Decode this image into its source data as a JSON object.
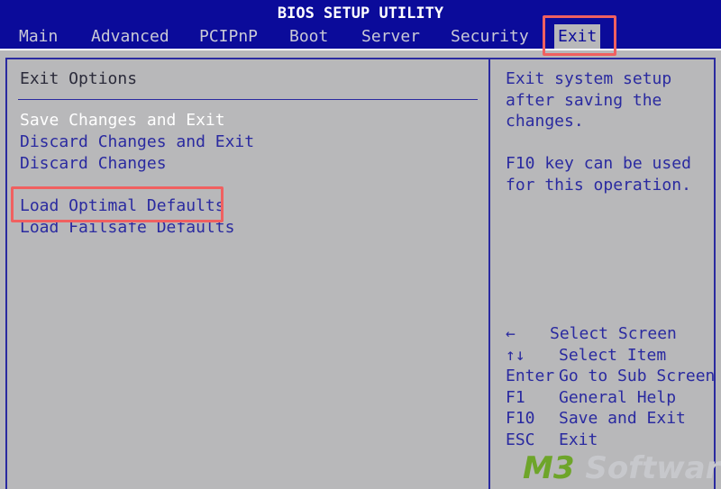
{
  "title": "BIOS SETUP UTILITY",
  "menu": [
    {
      "label": "Main"
    },
    {
      "label": "Advanced"
    },
    {
      "label": "PCIPnP"
    },
    {
      "label": "Boot"
    },
    {
      "label": "Server"
    },
    {
      "label": "Security"
    },
    {
      "label": "Exit"
    }
  ],
  "active_tab": "Exit",
  "main": {
    "section_title": "Exit Options",
    "options": [
      {
        "label": "Save Changes and Exit"
      },
      {
        "label": "Discard Changes and Exit"
      },
      {
        "label": "Discard Changes"
      },
      {
        "label": "Load Optimal Defaults"
      },
      {
        "label": "Load Failsafe Defaults"
      }
    ]
  },
  "help": {
    "lines": [
      "Exit system setup",
      "after saving the",
      "changes."
    ],
    "lines2": [
      "F10 key can be used",
      "for this operation."
    ]
  },
  "keys": [
    {
      "key": "←",
      "desc": "Select Screen"
    },
    {
      "key": "↑↓",
      "desc": "Select Item"
    },
    {
      "key": "Enter",
      "desc": "Go to Sub Screen"
    },
    {
      "key": "F1",
      "desc": "General Help"
    },
    {
      "key": "F10",
      "desc": "Save and Exit"
    },
    {
      "key": "ESC",
      "desc": "Exit"
    }
  ],
  "watermark": {
    "part1": "M3",
    "part2": " Software"
  },
  "colors": {
    "header_bg": "#0b0b9a",
    "panel_bg": "#b8b8ba",
    "text": "#2a2aa0",
    "selected_text": "#ffffff",
    "highlight": "#f06060",
    "watermark_green": "#6ea52a"
  }
}
